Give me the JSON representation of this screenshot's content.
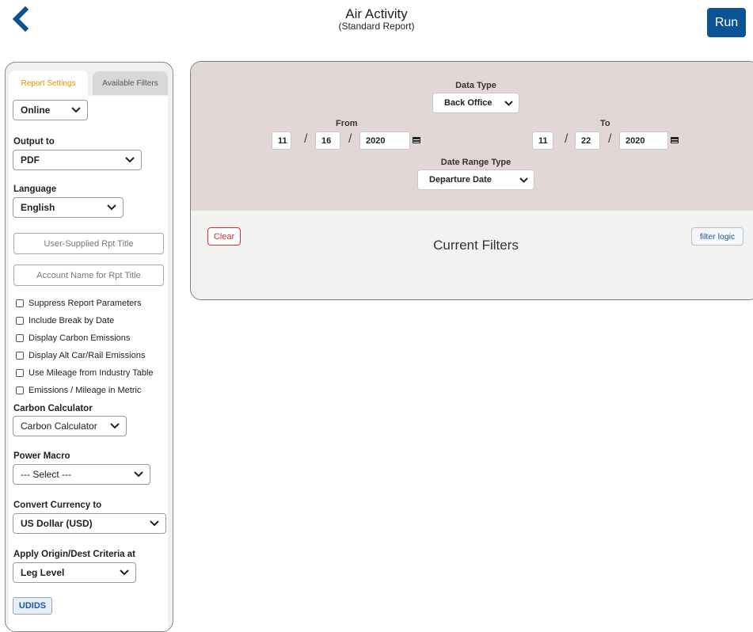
{
  "header": {
    "back_icon": "chevron-left-icon",
    "title": "Air Activity",
    "subtitle": "(Standard Report)",
    "run_label": "Run",
    "accent_color": "#0b5394"
  },
  "left_panel": {
    "tabs": [
      {
        "label": "Report Settings",
        "active": true
      },
      {
        "label": "Available Filters",
        "active": false
      }
    ],
    "mode_select": "Online",
    "output_to": {
      "label": "Output to",
      "value": "PDF"
    },
    "language": {
      "label": "Language",
      "value": "English"
    },
    "user_title_placeholder": "User-Supplied Rpt Title",
    "account_title_placeholder": "Account Name for Rpt Title",
    "checkboxes": [
      {
        "label": "Suppress Report Parameters",
        "checked": false
      },
      {
        "label": "Include Break by Date",
        "checked": false
      },
      {
        "label": "Display Carbon Emissions",
        "checked": false
      },
      {
        "label": "Display Alt Car/Rail Emissions",
        "checked": false
      },
      {
        "label": "Use Mileage from Industry Table",
        "checked": false
      },
      {
        "label": "Emissions / Mileage in Metric",
        "checked": false
      }
    ],
    "carbon_calculator": {
      "label": "Carbon Calculator",
      "value": "Carbon Calculator"
    },
    "power_macro": {
      "label": "Power Macro",
      "value": "--- Select ---"
    },
    "convert_currency": {
      "label": "Convert Currency to",
      "value": "US Dollar (USD)"
    },
    "origin_dest": {
      "label": "Apply Origin/Dest Criteria at",
      "value": "Leg Level"
    },
    "udids_label": "UDIDS"
  },
  "right_panel": {
    "data_type": {
      "label": "Data Type",
      "value": "Back Office"
    },
    "from": {
      "label": "From",
      "month": "11",
      "day": "16",
      "year": "2020"
    },
    "to": {
      "label": "To",
      "month": "11",
      "day": "22",
      "year": "2020"
    },
    "date_sep": "/",
    "date_range_type": {
      "label": "Date Range Type",
      "value": "Departure Date"
    },
    "clear_label": "Clear",
    "filter_logic_label": "filter logic",
    "current_filters_label": "Current Filters"
  }
}
